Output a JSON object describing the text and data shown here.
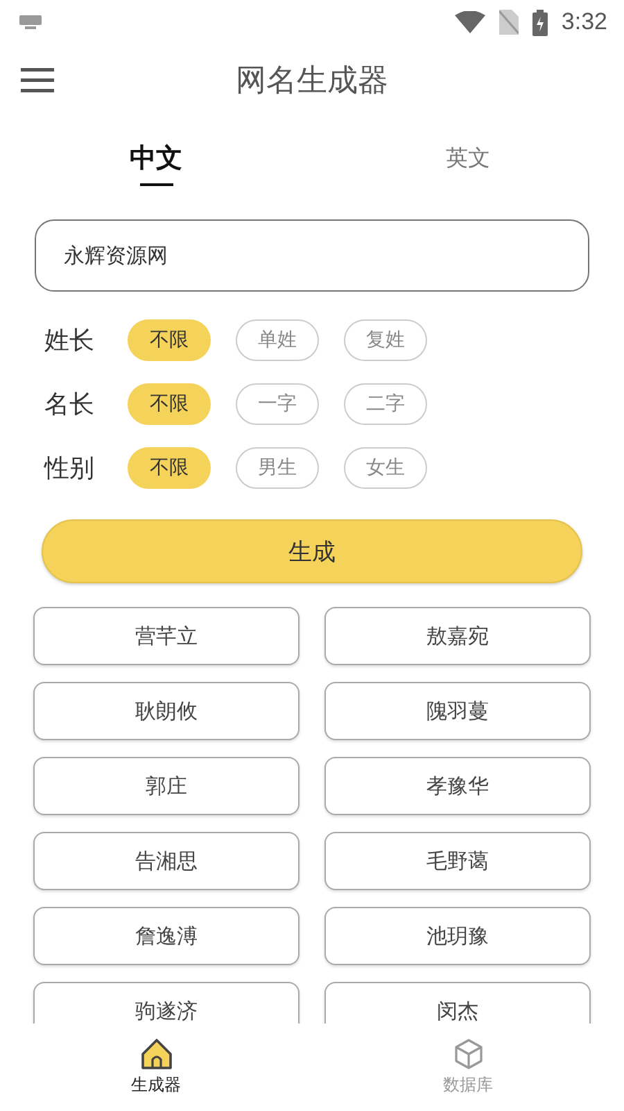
{
  "status_bar": {
    "time": "3:32"
  },
  "header": {
    "title": "网名生成器"
  },
  "tabs": [
    {
      "label": "中文",
      "selected": true
    },
    {
      "label": "英文",
      "selected": false
    }
  ],
  "input": {
    "value": "永辉资源网"
  },
  "options": [
    {
      "label": "姓长",
      "choices": [
        {
          "label": "不限",
          "selected": true
        },
        {
          "label": "单姓",
          "selected": false
        },
        {
          "label": "复姓",
          "selected": false
        }
      ]
    },
    {
      "label": "名长",
      "choices": [
        {
          "label": "不限",
          "selected": true
        },
        {
          "label": "一字",
          "selected": false
        },
        {
          "label": "二字",
          "selected": false
        }
      ]
    },
    {
      "label": "性别",
      "choices": [
        {
          "label": "不限",
          "selected": true
        },
        {
          "label": "男生",
          "selected": false
        },
        {
          "label": "女生",
          "selected": false
        }
      ]
    }
  ],
  "generate_button": "生成",
  "results": [
    "营芊立",
    "敖嘉宛",
    "耿朗攸",
    "隗羽蔓",
    "郭庄",
    "孝豫华",
    "告湘思",
    "毛野蔼",
    "詹逸溥",
    "池玥豫",
    "驹遂济",
    "闵杰"
  ],
  "bottom_nav": [
    {
      "label": "生成器",
      "selected": true,
      "kind": "home"
    },
    {
      "label": "数据库",
      "selected": false,
      "kind": "cube"
    }
  ]
}
